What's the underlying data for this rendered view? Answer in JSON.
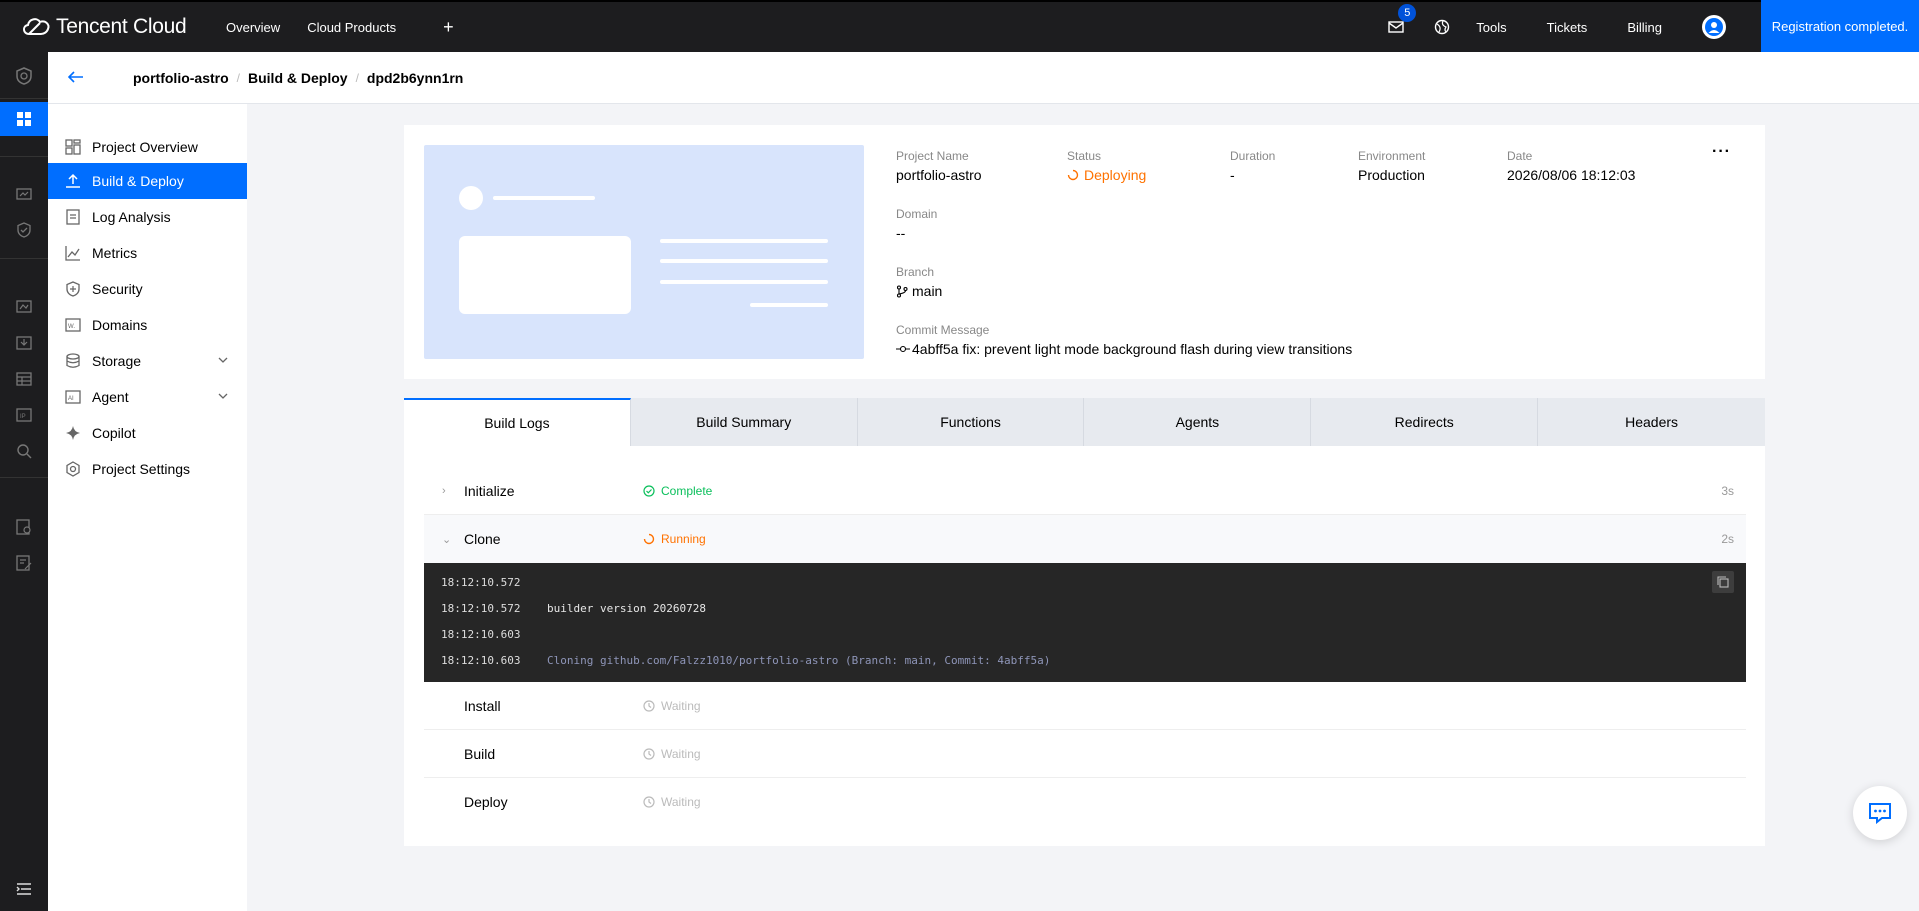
{
  "topbar": {
    "brand": "Tencent Cloud",
    "nav": [
      "Overview",
      "Cloud Products"
    ],
    "plus": "+",
    "mail_badge": "5",
    "links": [
      "Tools",
      "Tickets",
      "Billing"
    ],
    "registration": "Registration completed."
  },
  "breadcrumb": {
    "items": [
      "portfolio-astro",
      "Build & Deploy",
      "dpd2b6ynn1rn"
    ],
    "separator": "/"
  },
  "sidebar": {
    "items": [
      {
        "label": "Project Overview",
        "icon": "dashboard-icon"
      },
      {
        "label": "Build & Deploy",
        "icon": "upload-icon",
        "active": true
      },
      {
        "label": "Log Analysis",
        "icon": "document-icon"
      },
      {
        "label": "Metrics",
        "icon": "line-chart-icon"
      },
      {
        "label": "Security",
        "icon": "shield-icon"
      },
      {
        "label": "Domains",
        "icon": "domain-icon"
      },
      {
        "label": "Storage",
        "icon": "database-icon",
        "expandable": true
      },
      {
        "label": "Agent",
        "icon": "ai-icon",
        "expandable": true
      },
      {
        "label": "Copilot",
        "icon": "sparkle-icon"
      },
      {
        "label": "Project Settings",
        "icon": "settings-icon"
      }
    ]
  },
  "deployment": {
    "project_name_label": "Project Name",
    "project_name": "portfolio-astro",
    "status_label": "Status",
    "status": "Deploying",
    "duration_label": "Duration",
    "duration": "-",
    "environment_label": "Environment",
    "environment": "Production",
    "date_label": "Date",
    "date": "2026/08/06 18:12:03",
    "domain_label": "Domain",
    "domain": "--",
    "branch_label": "Branch",
    "branch": "main",
    "commit_label": "Commit Message",
    "commit": "4abff5a fix: prevent light mode background flash during view transitions",
    "more": "···"
  },
  "tabs": [
    "Build Logs",
    "Build Summary",
    "Functions",
    "Agents",
    "Redirects",
    "Headers"
  ],
  "steps": [
    {
      "name": "Initialize",
      "status": "Complete",
      "duration": "3s",
      "arrow": "›"
    },
    {
      "name": "Clone",
      "status": "Running",
      "duration": "2s",
      "arrow": "⌄"
    },
    {
      "name": "Install",
      "status": "Waiting",
      "duration": ""
    },
    {
      "name": "Build",
      "status": "Waiting",
      "duration": ""
    },
    {
      "name": "Deploy",
      "status": "Waiting",
      "duration": ""
    }
  ],
  "console": [
    {
      "time": "18:12:10.572",
      "msg": ""
    },
    {
      "time": "18:12:10.572",
      "msg": "builder version 20260728"
    },
    {
      "time": "18:12:10.603",
      "msg": ""
    },
    {
      "time": "18:12:10.603",
      "msg": "Cloning github.com/Falzz1010/portfolio-astro (Branch: main, Commit: 4abff5a)"
    }
  ],
  "colors": {
    "accent": "#006eff",
    "complete": "#0abf5b",
    "running": "#ff7200",
    "waiting": "#bbbbbb",
    "topbar": "#1d1d1f"
  }
}
